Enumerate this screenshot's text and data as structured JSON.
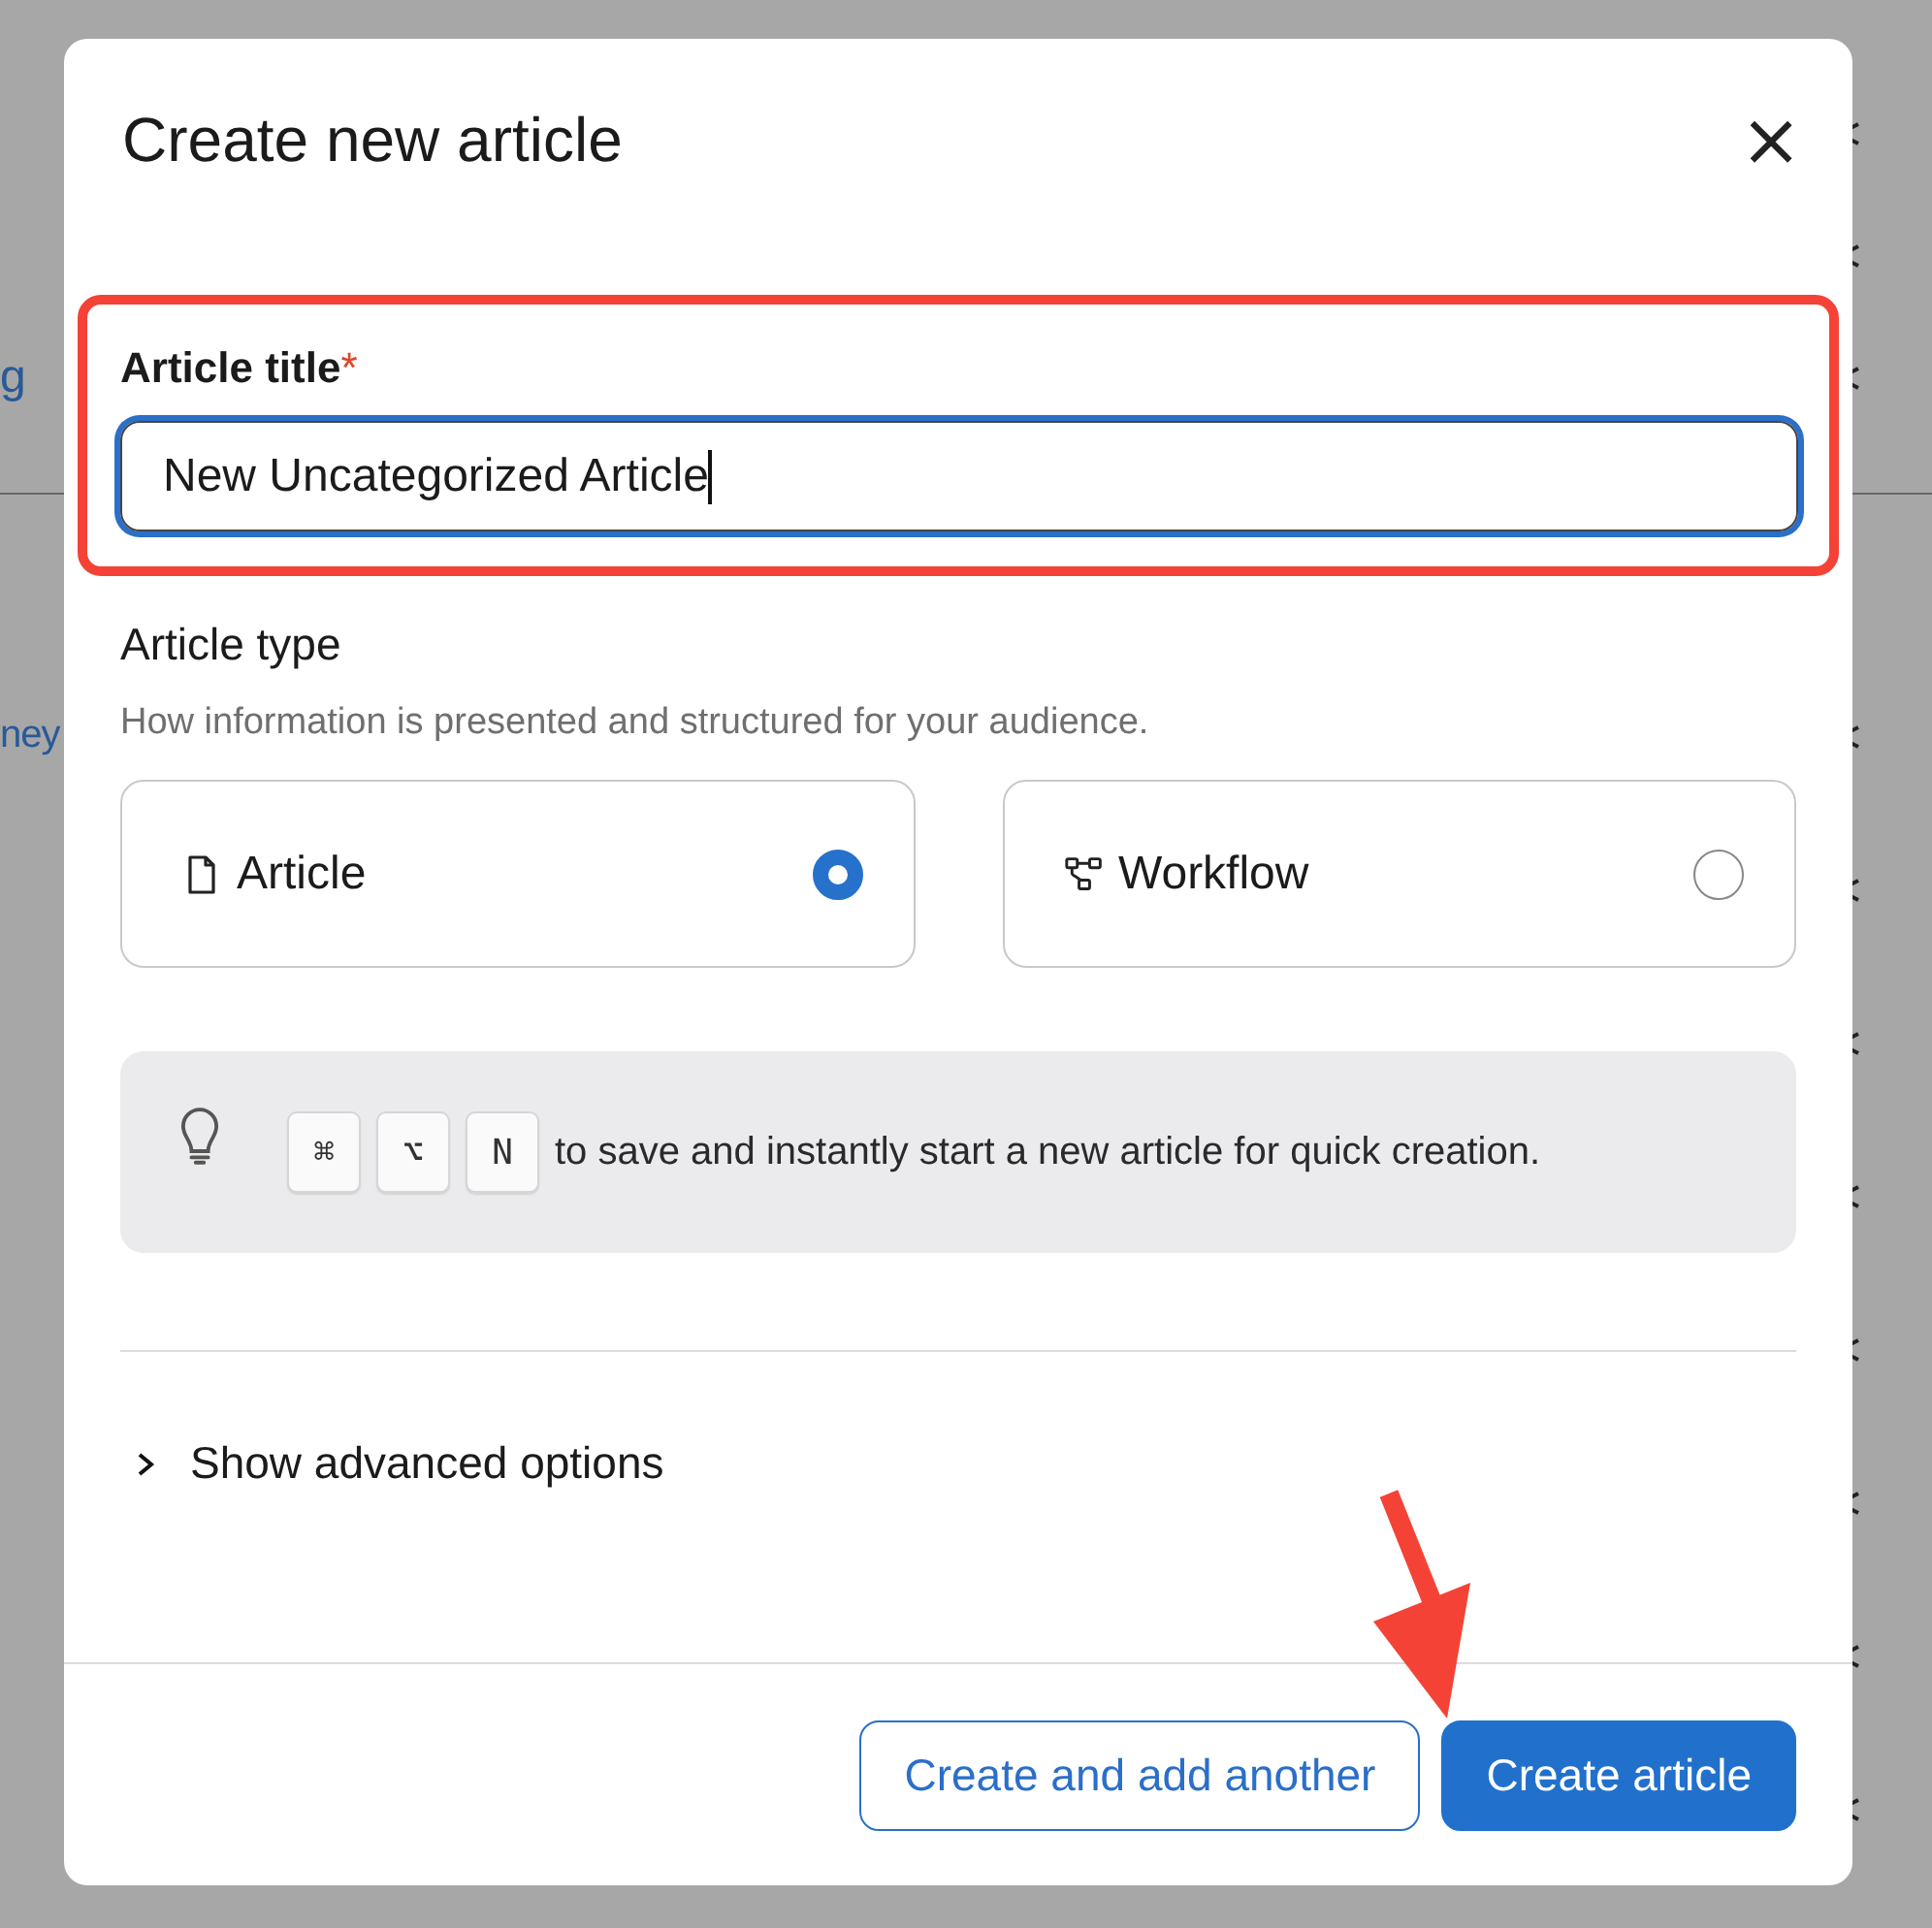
{
  "background": {
    "links": [
      "g",
      "ney"
    ]
  },
  "dialog": {
    "title": "Create new article",
    "close": "×",
    "title_field": {
      "label": "Article title",
      "required_mark": "*",
      "value": "New Uncategorized Article",
      "focused": true
    },
    "article_type": {
      "heading": "Article type",
      "description": "How information is presented and structured for your audience.",
      "options": [
        {
          "kind": "article",
          "label": "Article",
          "selected": true
        },
        {
          "kind": "workflow",
          "label": "Workflow",
          "selected": false
        }
      ]
    },
    "tip": {
      "keys": [
        "⌘",
        "⌥",
        "N"
      ],
      "text": "to save and instantly start a new article for quick creation."
    },
    "advanced": {
      "label": "Show advanced options",
      "expanded": false
    },
    "buttons": [
      {
        "kind": "secondary",
        "label": "Create and add another"
      },
      {
        "kind": "primary",
        "label": "Create article"
      }
    ]
  }
}
